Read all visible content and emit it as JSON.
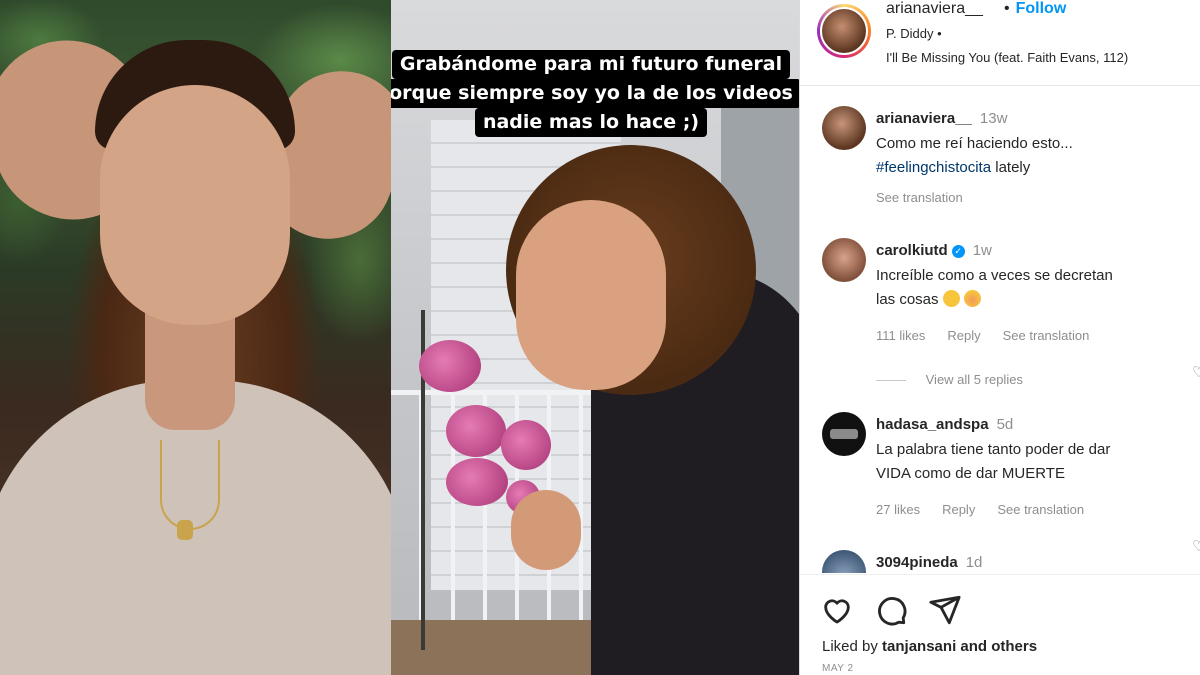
{
  "video": {
    "caption_lines": [
      "Grabándome para mi futuro funeral",
      "orque siempre soy yo la de los videos",
      "nadie mas lo hace ;)"
    ]
  },
  "post": {
    "username": "arianaviera__",
    "follow_separator": "•",
    "follow_label": "Follow",
    "artist": "P. Diddy •",
    "song": "I'll Be Missing You (feat. Faith Evans, 112)"
  },
  "comments": [
    {
      "user": "arianaviera__",
      "time": "13w",
      "text_line1": "Como me reí haciendo esto...",
      "hashtag": "#feelingchistocita",
      "text_line2_rest": " lately",
      "see_translation": "See translation"
    },
    {
      "user": "carolkiutd",
      "verified_mark": "✓",
      "time": "1w",
      "text_line1": "Increíble como a veces se decretan",
      "text_line2": "las cosas",
      "likes": "111 likes",
      "reply": "Reply",
      "see_translation": "See translation",
      "view_replies": "View all 5 replies"
    },
    {
      "user": "hadasa_andspa",
      "time": "5d",
      "text_line1": "La palabra tiene tanto poder de dar",
      "text_line2": "VIDA como de dar MUERTE",
      "likes": "27 likes",
      "reply": "Reply",
      "see_translation": "See translation"
    },
    {
      "user": "3094pineda",
      "time": "1d"
    }
  ],
  "footer": {
    "liked_by_prefix": "Liked by ",
    "liked_by_user": "tanjansani",
    "liked_by_suffix": " and others",
    "date": "MAY 2"
  },
  "icons": {
    "like": "heart-icon",
    "comment": "comment-icon",
    "share": "send-icon",
    "comment_like": "heart-outline-icon"
  },
  "colors": {
    "link_blue": "#0095f6",
    "hashtag": "#00376b",
    "secondary_text": "#8e8e8e"
  }
}
